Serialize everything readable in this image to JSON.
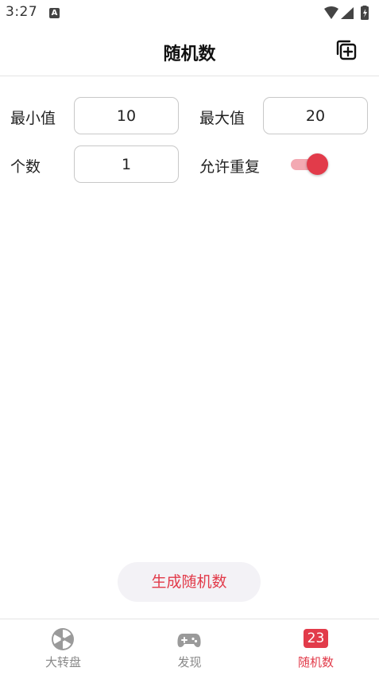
{
  "status_bar": {
    "time": "3:27",
    "notif_glyph": "A"
  },
  "header": {
    "title": "随机数",
    "copy_icon": "copy-add-icon"
  },
  "form": {
    "min_label": "最小值",
    "min_value": "10",
    "max_label": "最大值",
    "max_value": "20",
    "count_label": "个数",
    "count_value": "1",
    "repeat_label": "允许重复",
    "repeat_enabled": true
  },
  "generate_button": {
    "label": "生成随机数"
  },
  "tabbar": {
    "tabs": [
      {
        "label": "大转盘",
        "icon": "wheel-icon",
        "active": false
      },
      {
        "label": "发现",
        "icon": "gamepad-icon",
        "active": false
      },
      {
        "label": "随机数",
        "icon": "number-badge-icon",
        "badge": "23",
        "active": true
      }
    ]
  },
  "colors": {
    "accent": "#e23b4a",
    "toggle_track": "#f3a9b2",
    "button_bg": "#f3f2f6",
    "inactive": "#888888"
  }
}
